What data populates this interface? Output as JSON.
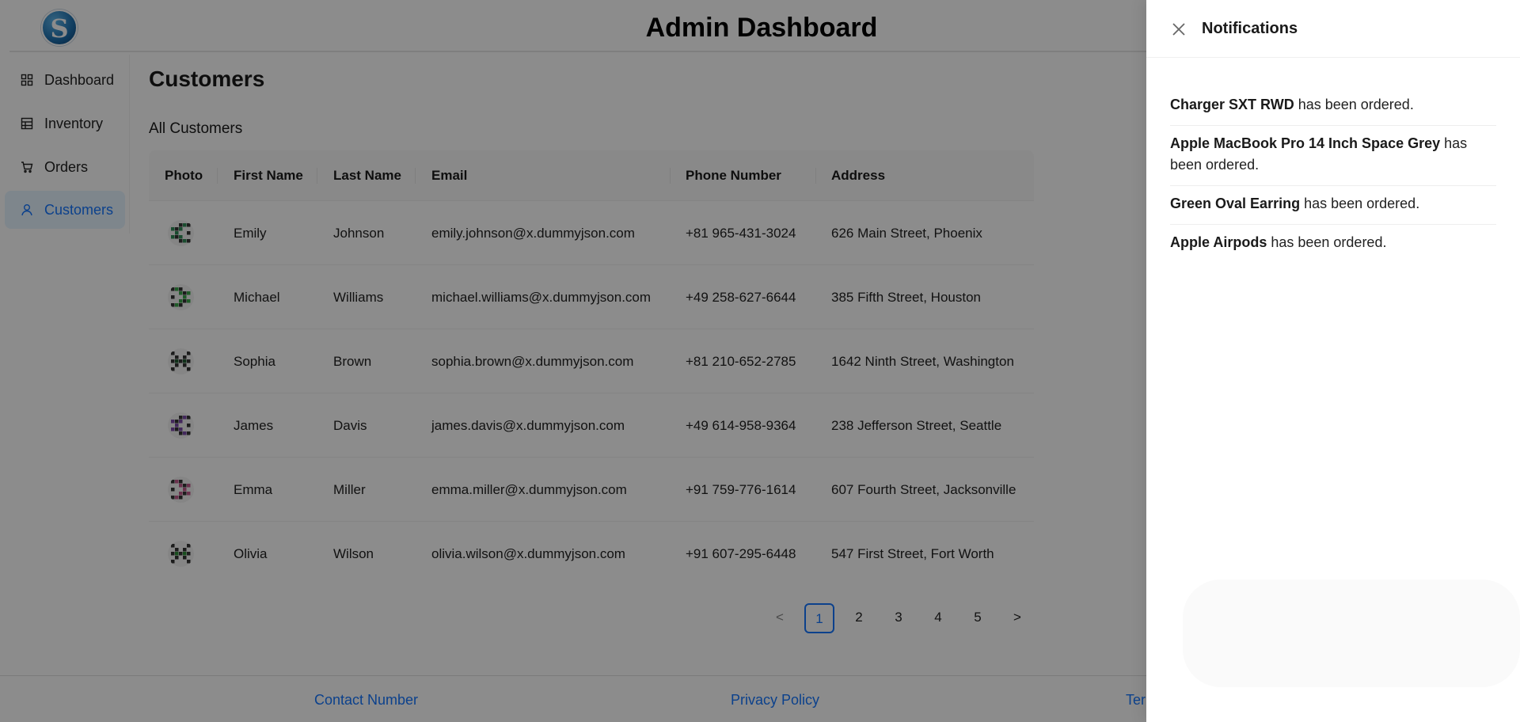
{
  "header": {
    "logo_letter": "S",
    "title": "Admin Dashboard"
  },
  "sidebar": {
    "items": [
      {
        "label": "Dashboard",
        "icon": "dashboard-icon",
        "active": false
      },
      {
        "label": "Inventory",
        "icon": "inventory-icon",
        "active": false
      },
      {
        "label": "Orders",
        "icon": "cart-icon",
        "active": false
      },
      {
        "label": "Customers",
        "icon": "user-icon",
        "active": true
      }
    ]
  },
  "main": {
    "page_title": "Customers",
    "section_title": "All Customers",
    "table": {
      "columns": [
        "Photo",
        "First Name",
        "Last Name",
        "Email",
        "Phone Number",
        "Address"
      ],
      "rows": [
        {
          "first": "Emily",
          "last": "Johnson",
          "email": "emily.johnson@x.dummyjson.com",
          "phone": "+81 965-431-3024",
          "address": "626 Main Street, Phoenix",
          "avatar_color": "#2e8b57"
        },
        {
          "first": "Michael",
          "last": "Williams",
          "email": "michael.williams@x.dummyjson.com",
          "phone": "+49 258-627-6644",
          "address": "385 Fifth Street, Houston",
          "avatar_color": "#3aa64a"
        },
        {
          "first": "Sophia",
          "last": "Brown",
          "email": "sophia.brown@x.dummyjson.com",
          "phone": "+81 210-652-2785",
          "address": "1642 Ninth Street, Washington",
          "avatar_color": "#1f5a30"
        },
        {
          "first": "James",
          "last": "Davis",
          "email": "james.davis@x.dummyjson.com",
          "phone": "+49 614-958-9364",
          "address": "238 Jefferson Street, Seattle",
          "avatar_color": "#7b4aa8"
        },
        {
          "first": "Emma",
          "last": "Miller",
          "email": "emma.miller@x.dummyjson.com",
          "phone": "+91 759-776-1614",
          "address": "607 Fourth Street, Jacksonville",
          "avatar_color": "#c25a8c"
        },
        {
          "first": "Olivia",
          "last": "Wilson",
          "email": "olivia.wilson@x.dummyjson.com",
          "phone": "+91 607-295-6448",
          "address": "547 First Street, Fort Worth",
          "avatar_color": "#2f8f3a"
        }
      ]
    },
    "pagination": {
      "prev": "<",
      "pages": [
        "1",
        "2",
        "3",
        "4",
        "5"
      ],
      "current": "1",
      "next": ">"
    }
  },
  "footer": {
    "links": [
      "Contact Number",
      "Privacy Policy",
      "Ter"
    ]
  },
  "drawer": {
    "title": "Notifications",
    "items": [
      {
        "product": "Charger SXT RWD",
        "suffix": " has been ordered."
      },
      {
        "product": "Apple MacBook Pro 14 Inch Space Grey",
        "suffix": " has been ordered."
      },
      {
        "product": "Green Oval Earring",
        "suffix": " has been ordered."
      },
      {
        "product": "Apple Airpods",
        "suffix": " has been ordered."
      }
    ]
  },
  "colors": {
    "accent": "#1677ff",
    "active_bg": "#e6f4ff",
    "mask": "rgba(0,0,0,0.45)"
  }
}
